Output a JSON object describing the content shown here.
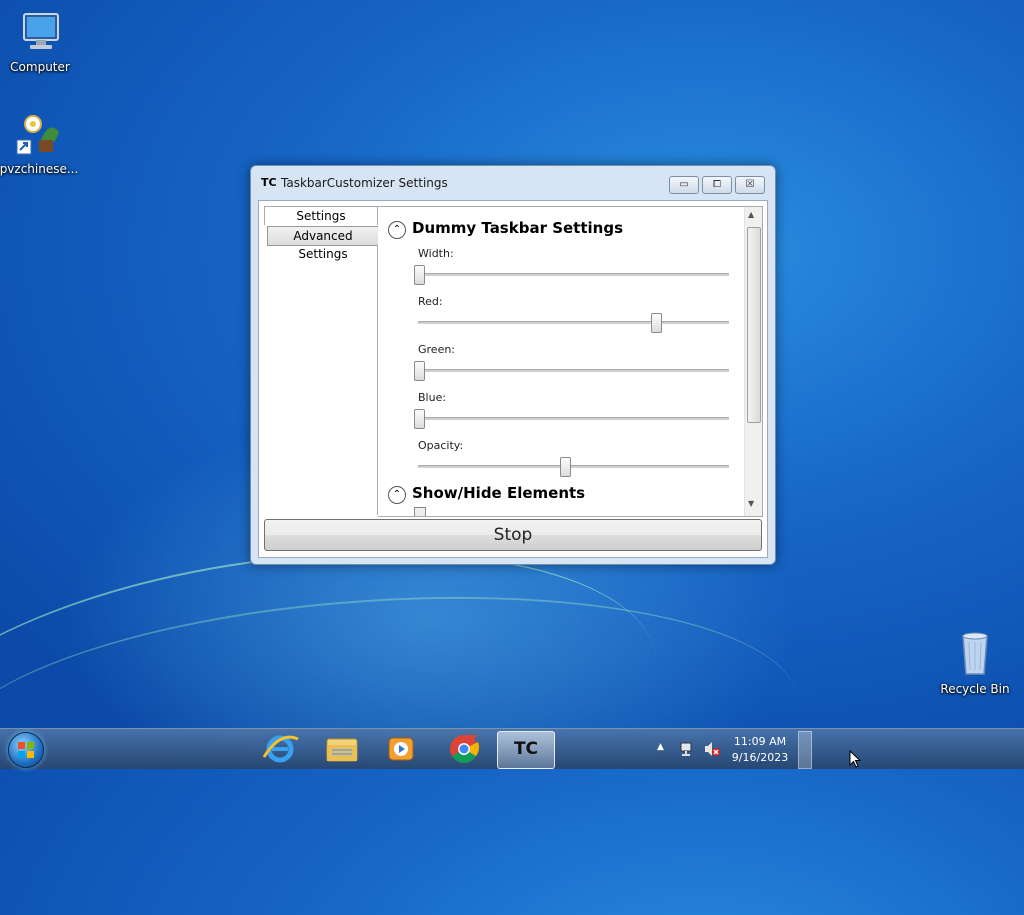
{
  "desktop": {
    "icons": [
      {
        "label": "Computer"
      },
      {
        "label": "pvzchinese..."
      },
      {
        "label": "Recycle Bin"
      }
    ]
  },
  "window": {
    "title": "TaskbarCustomizer Settings",
    "app_icon_text": "TC",
    "controls": {
      "minimize": "▭",
      "maximize": "⧠",
      "close": "☒"
    },
    "tabs": [
      {
        "label": "Settings",
        "selected": true
      },
      {
        "label": "Advanced Settings",
        "selected": false
      }
    ],
    "sections": [
      {
        "title": "Dummy Taskbar Settings",
        "expanded": true
      },
      {
        "title": "Show/Hide Elements",
        "expanded": true
      }
    ],
    "sliders": [
      {
        "label": "Width:",
        "value_fraction": 0.0
      },
      {
        "label": "Red:",
        "value_fraction": 0.75
      },
      {
        "label": "Green:",
        "value_fraction": 0.0
      },
      {
        "label": "Blue:",
        "value_fraction": 0.0
      },
      {
        "label": "Opacity:",
        "value_fraction": 0.47
      }
    ],
    "stop_button": "Stop"
  },
  "taskbar": {
    "apps": [
      {
        "name": "internet-explorer"
      },
      {
        "name": "file-explorer"
      },
      {
        "name": "media-player"
      },
      {
        "name": "chrome"
      },
      {
        "name": "taskbar-customizer",
        "label": "TC",
        "active": true
      }
    ],
    "clock": {
      "time": "11:09 AM",
      "date": "9/16/2023"
    }
  },
  "colors": {
    "desktop": "#1766c8",
    "window_frame": "#d6e4f3",
    "accent": "#2a8fe0"
  }
}
